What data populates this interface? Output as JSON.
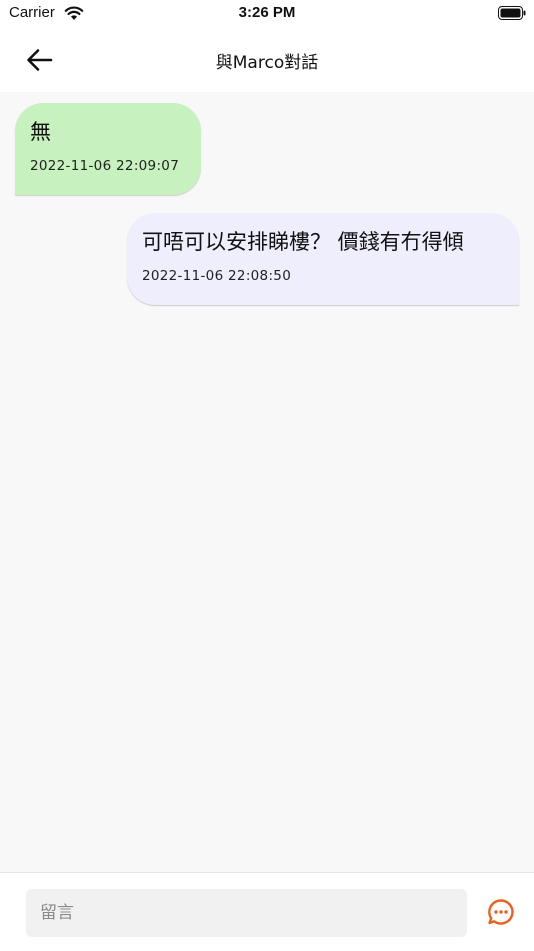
{
  "status_bar": {
    "carrier": "Carrier",
    "time": "3:26 PM",
    "wifi_icon": "wifi-icon",
    "battery_icon": "battery-icon"
  },
  "header": {
    "title": "與Marco對話",
    "back_icon": "arrow-left-icon"
  },
  "messages": [
    {
      "direction": "received",
      "text": "無",
      "time": "2022-11-06 22:09:07",
      "color": "#c7f2bf"
    },
    {
      "direction": "sent",
      "text": "可唔可以安排睇樓？ 價錢有冇得傾",
      "time": "2022-11-06 22:08:50",
      "color": "#eeeefc"
    }
  ],
  "composer": {
    "value": "",
    "placeholder": "留言",
    "send_icon": "chat-bubble-icon",
    "accent_color": "#e8621c"
  }
}
